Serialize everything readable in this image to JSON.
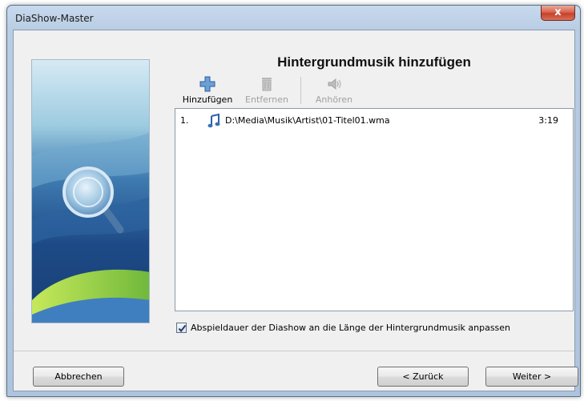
{
  "window": {
    "title": "DiaShow-Master",
    "close_label": "x"
  },
  "page": {
    "heading": "Hintergrundmusik hinzufügen"
  },
  "toolbar": {
    "add_label": "Hinzufügen",
    "remove_label": "Entfernen",
    "listen_label": "Anhören"
  },
  "tracks": [
    {
      "index": "1.",
      "path": "D:\\Media\\Musik\\Artist\\01-Titel01.wma",
      "duration": "3:19"
    }
  ],
  "options": {
    "fit_duration_label": "Abspieldauer der Diashow an die Länge der Hintergrundmusik anpassen",
    "fit_duration_checked": true
  },
  "buttons": {
    "cancel_label": "Abbrechen",
    "back_label": "< Zurück",
    "next_label": "Weiter >"
  },
  "colors": {
    "accent_blue": "#3b6fb6",
    "close_red": "#c7402a"
  }
}
